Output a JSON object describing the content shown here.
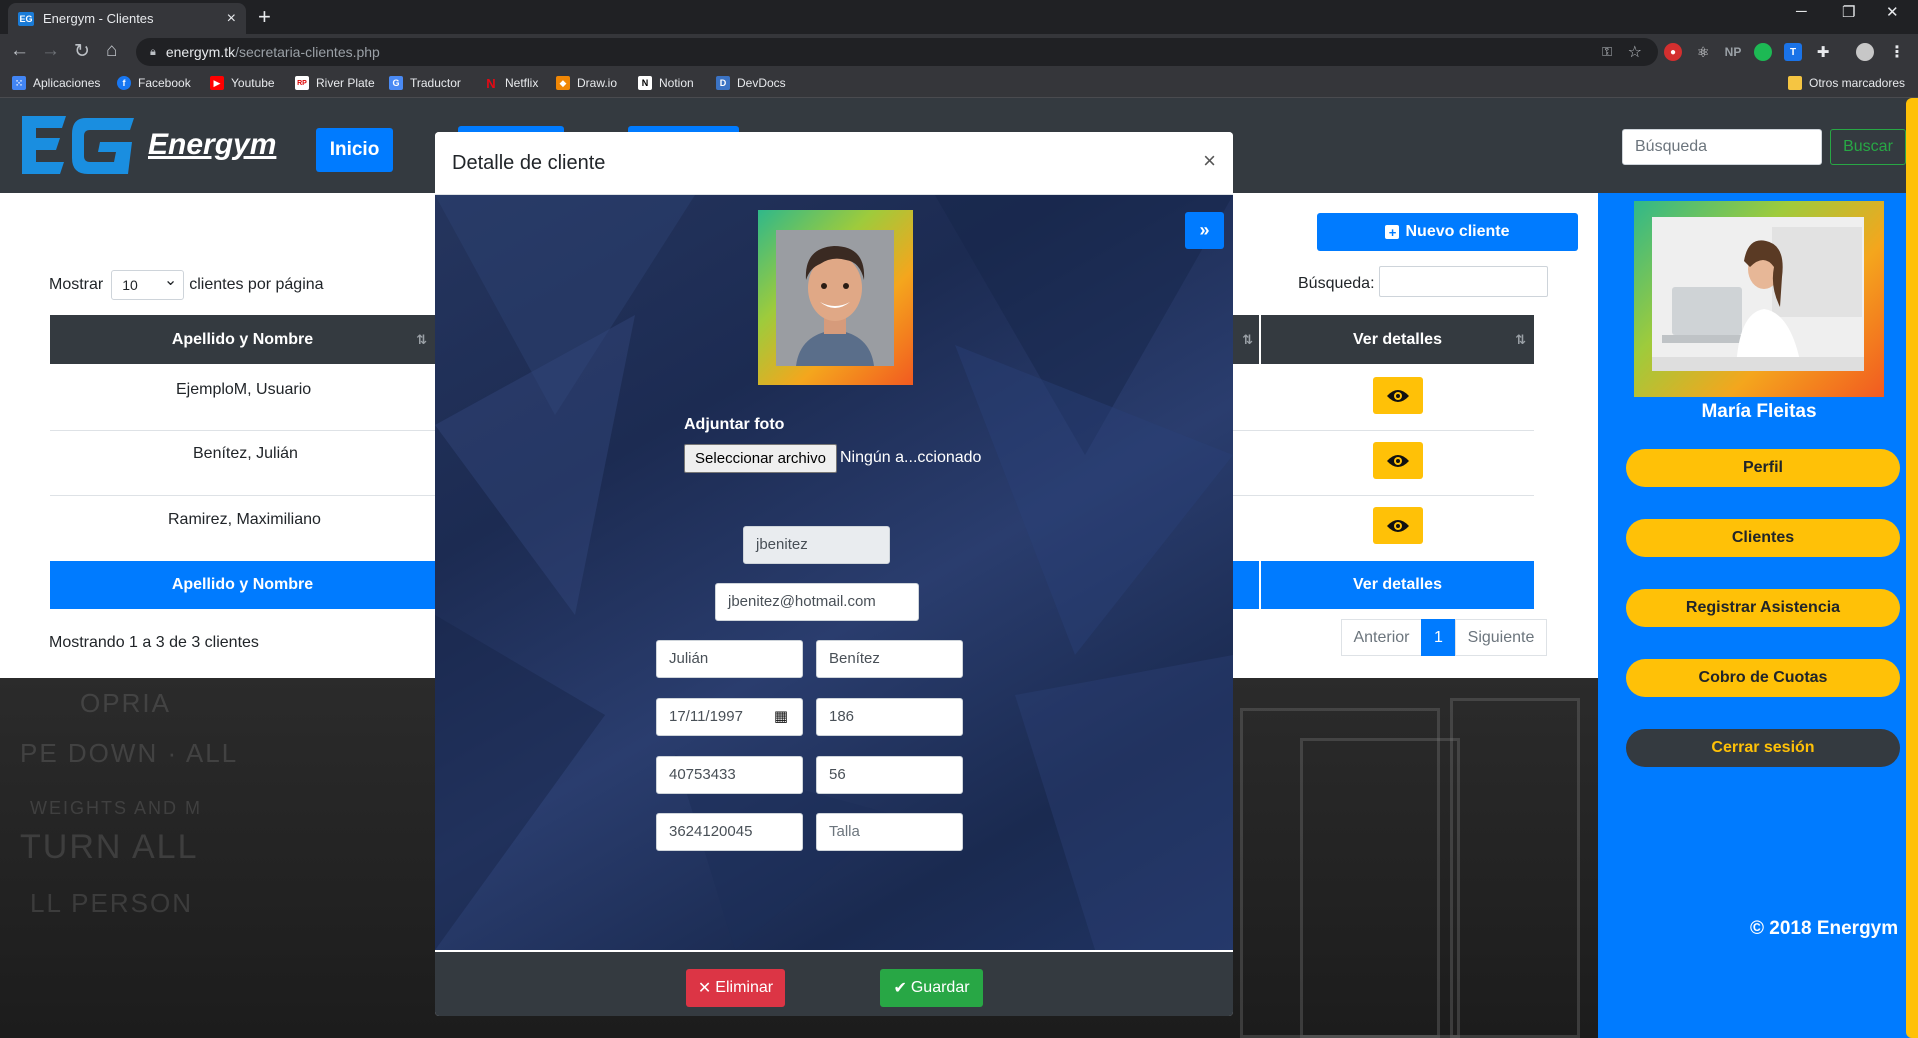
{
  "browser": {
    "tab_title": "Energym - Clientes",
    "url_host": "energym.tk",
    "url_path": "/secretaria-clientes.php",
    "bookmarks": [
      "Aplicaciones",
      "Facebook",
      "Youtube",
      "River Plate",
      "Traductor",
      "Netflix",
      "Draw.io",
      "Notion",
      "DevDocs"
    ],
    "other_bookmarks": "Otros marcadores"
  },
  "navbar": {
    "logo_text": "EG",
    "brand": "Energym",
    "inicio": "Inicio",
    "search_placeholder": "Búsqueda",
    "search_button": "Buscar"
  },
  "table_controls": {
    "show_prefix": "Mostrar",
    "page_size": "10",
    "show_suffix": "clientes por página",
    "search_label": "Búsqueda:",
    "new_client": "Nuevo cliente"
  },
  "table": {
    "header_name": "Apellido y Nombre",
    "header_details": "Ver detalles",
    "rows": [
      "EjemploM, Usuario",
      "Benítez, Julián",
      "Ramirez, Maximiliano"
    ],
    "footer_name": "Apellido y Nombre",
    "footer_details": "Ver detalles",
    "info": "Mostrando 1 a 3 de 3 clientes",
    "pagination": {
      "prev": "Anterior",
      "current": "1",
      "next": "Siguiente"
    }
  },
  "sidebar": {
    "user_name": "María Fleitas",
    "buttons": [
      "Perfil",
      "Clientes",
      "Registrar Asistencia",
      "Cobro de Cuotas"
    ],
    "logout": "Cerrar sesión",
    "copyright": "© 2018 Energym"
  },
  "modal": {
    "title": "Detalle de cliente",
    "close": "×",
    "expand": "»",
    "attach_label": "Adjuntar foto",
    "file_button": "Seleccionar archivo",
    "file_status": "Ningún a...ccionado",
    "username": "jbenitez",
    "email": "jbenitez@hotmail.com",
    "first_name": "Julián",
    "last_name": "Benítez",
    "birth_date": "17/11/1997",
    "height": "186",
    "dni": "40753433",
    "weight": "56",
    "phone": "3624120045",
    "size_placeholder": "Talla",
    "delete": "Eliminar",
    "save": "Guardar"
  },
  "colors": {
    "primary": "#007bff",
    "warning": "#ffc107",
    "dark": "#343a40",
    "danger": "#dc3545",
    "success": "#28a745"
  }
}
